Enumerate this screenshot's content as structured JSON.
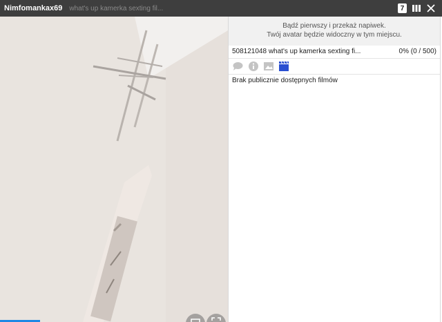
{
  "header": {
    "username": "Nimfomankax69",
    "subject": "what's up kamerka sexting fil...",
    "viewer_count": "7"
  },
  "video": {
    "progress_fraction": 0.09,
    "buttons": [
      "theater-mode",
      "fullscreen"
    ]
  },
  "sidebar": {
    "tip_line1": "Bądź pierwszy i przekaż napiwek.",
    "tip_line2": "Twój avatar będzie widoczny w tym miejscu.",
    "goal_text": "508121048 what's up kamerka sexting fi...",
    "goal_percent": "0% (0 / 500)",
    "tabs": [
      {
        "icon": "chat-icon",
        "active": false
      },
      {
        "icon": "info-icon",
        "active": false
      },
      {
        "icon": "image-icon",
        "active": false
      },
      {
        "icon": "video-clapper-icon",
        "active": true
      }
    ],
    "empty_message": "Brak publicznie dostępnych filmów"
  },
  "colors": {
    "topbar": "#3e3e3e",
    "accent": "#1e88e5",
    "active_tab": "#2a4fd1",
    "inactive_tab": "#c4c4c4"
  }
}
